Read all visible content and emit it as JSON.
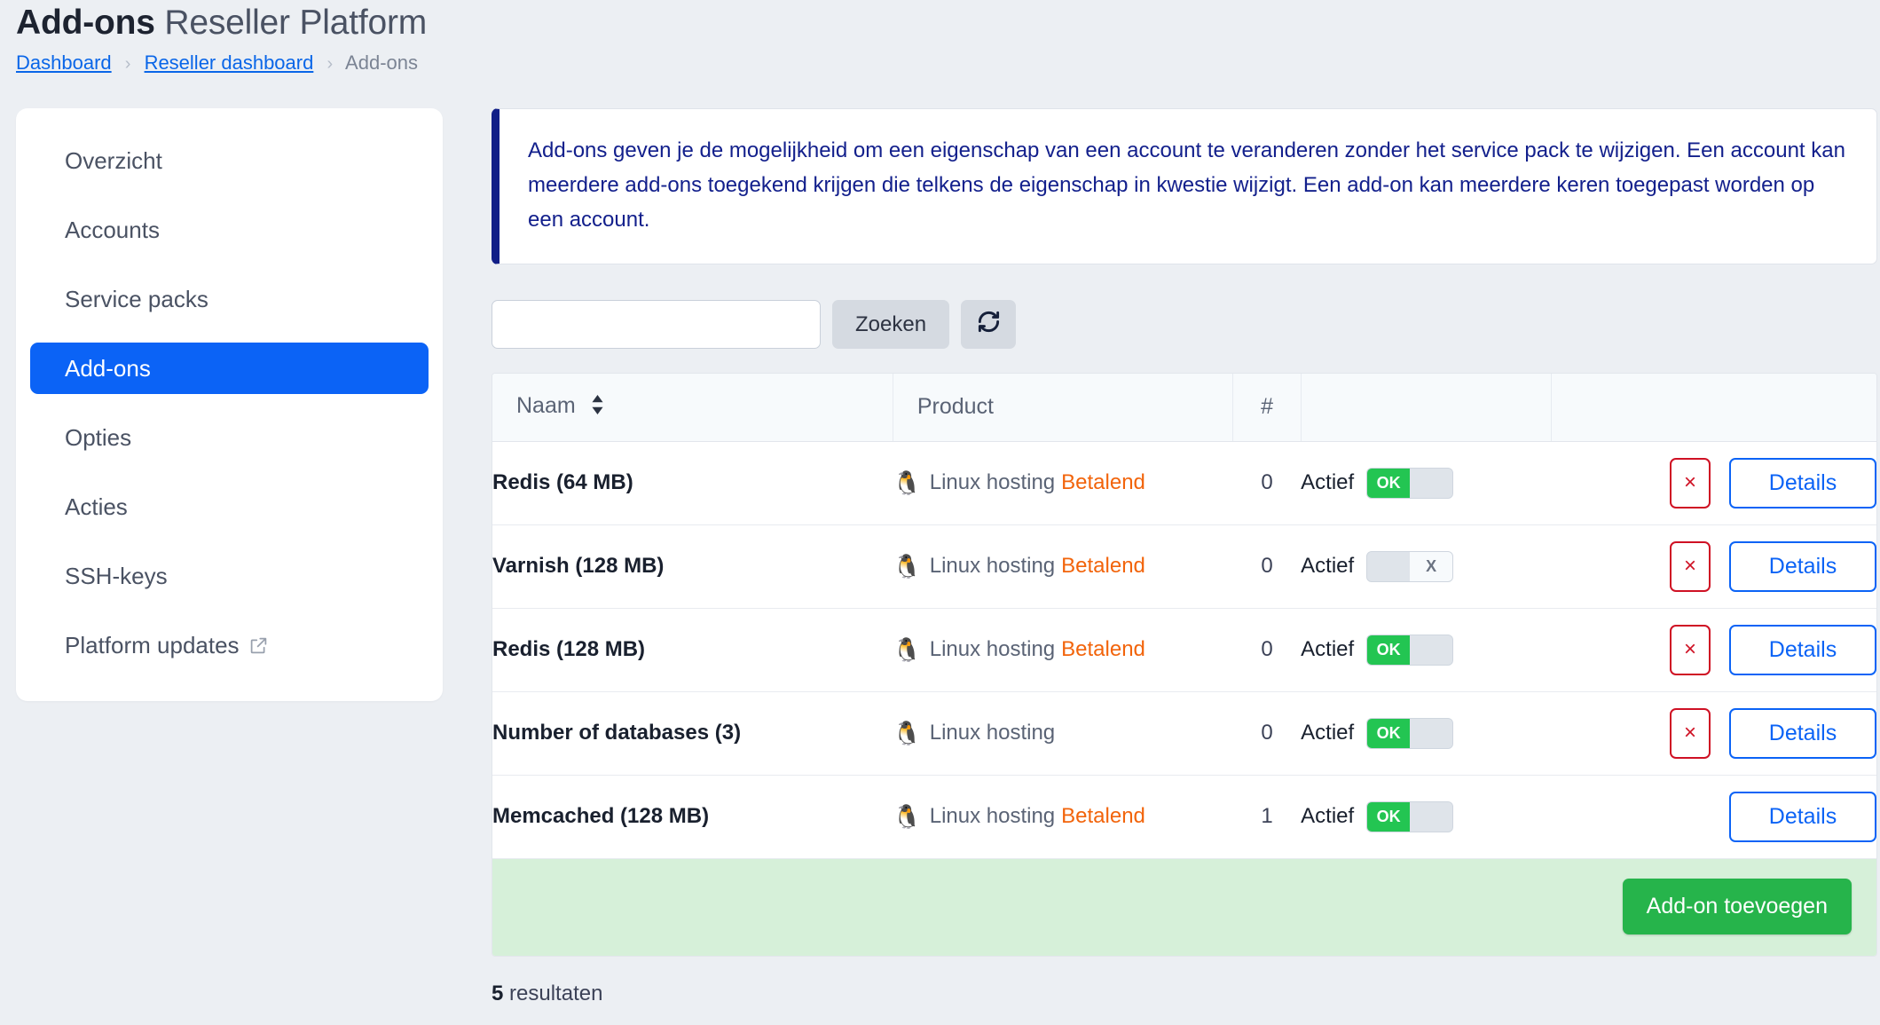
{
  "header": {
    "title_strong": "Add-ons",
    "title_rest": "Reseller Platform",
    "breadcrumb": {
      "item1": "Dashboard",
      "item2": "Reseller dashboard",
      "current": "Add-ons",
      "separator": "›"
    }
  },
  "sidebar": {
    "items": [
      {
        "label": "Overzicht",
        "active": false,
        "external": false
      },
      {
        "label": "Accounts",
        "active": false,
        "external": false
      },
      {
        "label": "Service packs",
        "active": false,
        "external": false
      },
      {
        "label": "Add-ons",
        "active": true,
        "external": false
      },
      {
        "label": "Opties",
        "active": false,
        "external": false
      },
      {
        "label": "Acties",
        "active": false,
        "external": false
      },
      {
        "label": "SSH-keys",
        "active": false,
        "external": false
      },
      {
        "label": "Platform updates",
        "active": false,
        "external": true
      }
    ]
  },
  "alert": {
    "text": "Add-ons geven je de mogelijkheid om een eigenschap van een account te veranderen zonder het service pack te wijzigen. Een account kan meerdere add-ons toegekend krijgen die telkens de eigenschap in kwestie wijzigt. Een add-on kan meerdere keren toegepast worden op een account."
  },
  "search": {
    "value": "",
    "placeholder": "",
    "button_label": "Zoeken",
    "refresh_icon": "refresh-icon"
  },
  "table": {
    "columns": [
      "Naam",
      "Product",
      "#",
      "",
      ""
    ],
    "sort_icon": "sort-icon",
    "rows": [
      {
        "name": "Redis (64 MB)",
        "product_icon": "linux-penguin-icon",
        "product": "Linux hosting",
        "paid_label": "Betalend",
        "count": "0",
        "status_label": "Actief",
        "toggle_state": "on",
        "toggle_on_text": "OK",
        "toggle_off_text": "X",
        "has_delete": true,
        "delete_label": "×",
        "details_label": "Details"
      },
      {
        "name": "Varnish (128 MB)",
        "product_icon": "linux-penguin-icon",
        "product": "Linux hosting",
        "paid_label": "Betalend",
        "count": "0",
        "status_label": "Actief",
        "toggle_state": "off",
        "toggle_on_text": "OK",
        "toggle_off_text": "X",
        "has_delete": true,
        "delete_label": "×",
        "details_label": "Details"
      },
      {
        "name": "Redis (128 MB)",
        "product_icon": "linux-penguin-icon",
        "product": "Linux hosting",
        "paid_label": "Betalend",
        "count": "0",
        "status_label": "Actief",
        "toggle_state": "on",
        "toggle_on_text": "OK",
        "toggle_off_text": "X",
        "has_delete": true,
        "delete_label": "×",
        "details_label": "Details"
      },
      {
        "name": "Number of databases (3)",
        "product_icon": "linux-penguin-icon",
        "product": "Linux hosting",
        "paid_label": "",
        "count": "0",
        "status_label": "Actief",
        "toggle_state": "on",
        "toggle_on_text": "OK",
        "toggle_off_text": "X",
        "has_delete": true,
        "delete_label": "×",
        "details_label": "Details"
      },
      {
        "name": "Memcached (128 MB)",
        "product_icon": "linux-penguin-icon",
        "product": "Linux hosting",
        "paid_label": "Betalend",
        "count": "1",
        "status_label": "Actief",
        "toggle_state": "on",
        "toggle_on_text": "OK",
        "toggle_off_text": "X",
        "has_delete": false,
        "delete_label": "×",
        "details_label": "Details"
      }
    ],
    "footer_button": "Add-on toevoegen"
  },
  "results": {
    "count": "5",
    "label": "resultaten"
  },
  "colors": {
    "page_bg": "#eceff3",
    "accent_blue": "#0b63f6",
    "link_blue": "#0a66e8",
    "alert_border": "#111f87",
    "alert_text": "#13208c",
    "paid_orange": "#f2640b",
    "toggle_green": "#23c552",
    "delete_red": "#cf1124",
    "add_green": "#26b44b",
    "footer_green_bg": "#d6f0d9"
  }
}
